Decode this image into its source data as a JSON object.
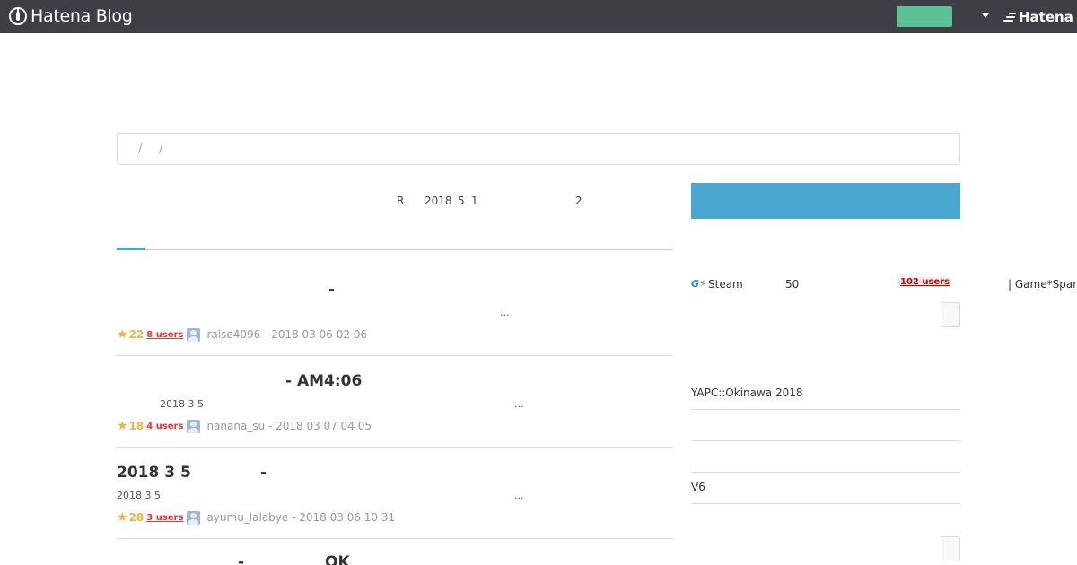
{
  "header": {
    "logo_text": "Hatena Blog",
    "brand_text": "Hatena"
  },
  "search": {
    "crumb_1": "/",
    "crumb_2": "/"
  },
  "notice": {
    "part_1": "R",
    "part_2": "2018",
    "part_3": "5",
    "part_4": "1",
    "part_5": "2"
  },
  "entries": [
    {
      "title": "-",
      "snippet": "...",
      "stars": "22",
      "users": "8 users",
      "byline": "raise4096 - 2018  03  06   02  06"
    },
    {
      "title": "- AM4:06",
      "snippet_date": "2018  3  5",
      "snippet": "...",
      "stars": "18",
      "users": "4 users",
      "byline": "nanana_su - 2018  03  07   04  05"
    },
    {
      "title": "2018  3  5",
      "title_dash": "-",
      "snippet_date": "2018  3  5",
      "snippet": "...",
      "stars": "28",
      "users": "3 users",
      "byline": "ayumu_lalabye - 2018  03  06   10  31"
    },
    {
      "title_dash": "-",
      "title": "OK"
    }
  ],
  "sidebar": {
    "ad_steam": "Steam",
    "ad_num": "50",
    "ad_users": "102 users",
    "ad_source": "| Game*Spark",
    "item_1": "YAPC::Okinawa 2018",
    "item_2": "V6"
  },
  "colors": {
    "topbar": "#3d3f44",
    "accent_green": "#5ec095",
    "accent_blue": "#4aa8d0",
    "star": "#f3b33d",
    "users_red": "#ee3333"
  }
}
